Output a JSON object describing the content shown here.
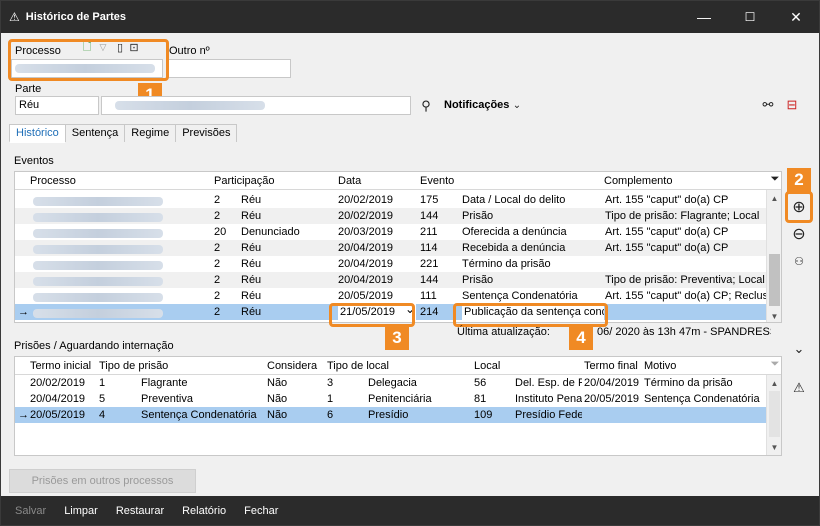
{
  "window": {
    "title": "Histórico de Partes",
    "minimize": "—",
    "maximize": "☐",
    "close": "✕"
  },
  "header": {
    "processo_label": "Processo",
    "outro_label": "Outro nº",
    "parte_label": "Parte",
    "parte_value": "Réu",
    "notificacoes_label": "Notificações"
  },
  "tabs": [
    "Histórico",
    "Sentença",
    "Regime",
    "Previsões"
  ],
  "eventos": {
    "section_label": "Eventos",
    "columns": [
      "Processo",
      "Participação",
      "",
      "Data",
      "Evento",
      "",
      "Complemento"
    ],
    "rows": [
      {
        "n": "2",
        "part": "Réu",
        "data": "20/02/2019",
        "cod": "175",
        "evento": "Data / Local do delito",
        "comp": "Art. 155 \"caput\" do(a) CP"
      },
      {
        "n": "2",
        "part": "Réu",
        "data": "20/02/2019",
        "cod": "144",
        "evento": "Prisão",
        "comp": "Tipo de prisão: Flagrante; Local"
      },
      {
        "n": "20",
        "part": "Denunciado",
        "data": "20/03/2019",
        "cod": "211",
        "evento": "Oferecida a denúncia",
        "comp": "Art. 155 \"caput\" do(a) CP"
      },
      {
        "n": "2",
        "part": "Réu",
        "data": "20/04/2019",
        "cod": "114",
        "evento": "Recebida a denúncia",
        "comp": "Art. 155 \"caput\" do(a) CP"
      },
      {
        "n": "2",
        "part": "Réu",
        "data": "20/04/2019",
        "cod": "221",
        "evento": "Término da prisão",
        "comp": ""
      },
      {
        "n": "2",
        "part": "Réu",
        "data": "20/04/2019",
        "cod": "144",
        "evento": "Prisão",
        "comp": "Tipo de prisão: Preventiva; Local"
      },
      {
        "n": "2",
        "part": "Réu",
        "data": "20/05/2019",
        "cod": "111",
        "evento": "Sentença Condenatória",
        "comp": "Art. 155 \"caput\" do(a) CP; Reclus"
      },
      {
        "n": "2",
        "part": "Réu",
        "data": "21/05/2019",
        "cod": "214",
        "evento": "Publicação da sentença cond",
        "comp": ""
      }
    ],
    "last_update_label": "Última atualização:",
    "last_update_value": "06/    2020 às 13h 47m  -  SPANDRESSA"
  },
  "prisoes": {
    "section_label": "Prisões / Aguardando internação",
    "columns": [
      "Termo inicial",
      "Tipo de prisão",
      "",
      "Considera",
      "Tipo de local",
      "",
      "Local",
      "",
      "Termo final",
      "Motivo"
    ],
    "rows": [
      {
        "inicio": "20/02/2019",
        "cod": "1",
        "tipo": "Flagrante",
        "considera": "Não",
        "tl": "3",
        "tipo_local": "Delegacia",
        "lc": "56",
        "local": "Del. Esp. de P",
        "fim": "20/04/2019",
        "motivo": "Término da prisão"
      },
      {
        "inicio": "20/04/2019",
        "cod": "5",
        "tipo": "Preventiva",
        "considera": "Não",
        "tl": "1",
        "tipo_local": "Penitenciária",
        "lc": "81",
        "local": "Instituto Pena",
        "fim": "20/05/2019",
        "motivo": "Sentença Condenatória"
      },
      {
        "inicio": "20/05/2019",
        "cod": "4",
        "tipo": "Sentença Condenatória",
        "considera": "Não",
        "tl": "6",
        "tipo_local": "Presídio",
        "lc": "109",
        "local": "Presídio Fede",
        "fim": "",
        "motivo": ""
      }
    ]
  },
  "buttons": {
    "outros": "Prisões em outros processos"
  },
  "footer": [
    "Salvar",
    "Limpar",
    "Restaurar",
    "Relatório",
    "Fechar"
  ],
  "annotations": [
    "1",
    "2",
    "3",
    "4"
  ],
  "colors": {
    "accent": "#f08a24",
    "selection": "#a9cdf0",
    "titlebar": "#2b2b2b"
  }
}
